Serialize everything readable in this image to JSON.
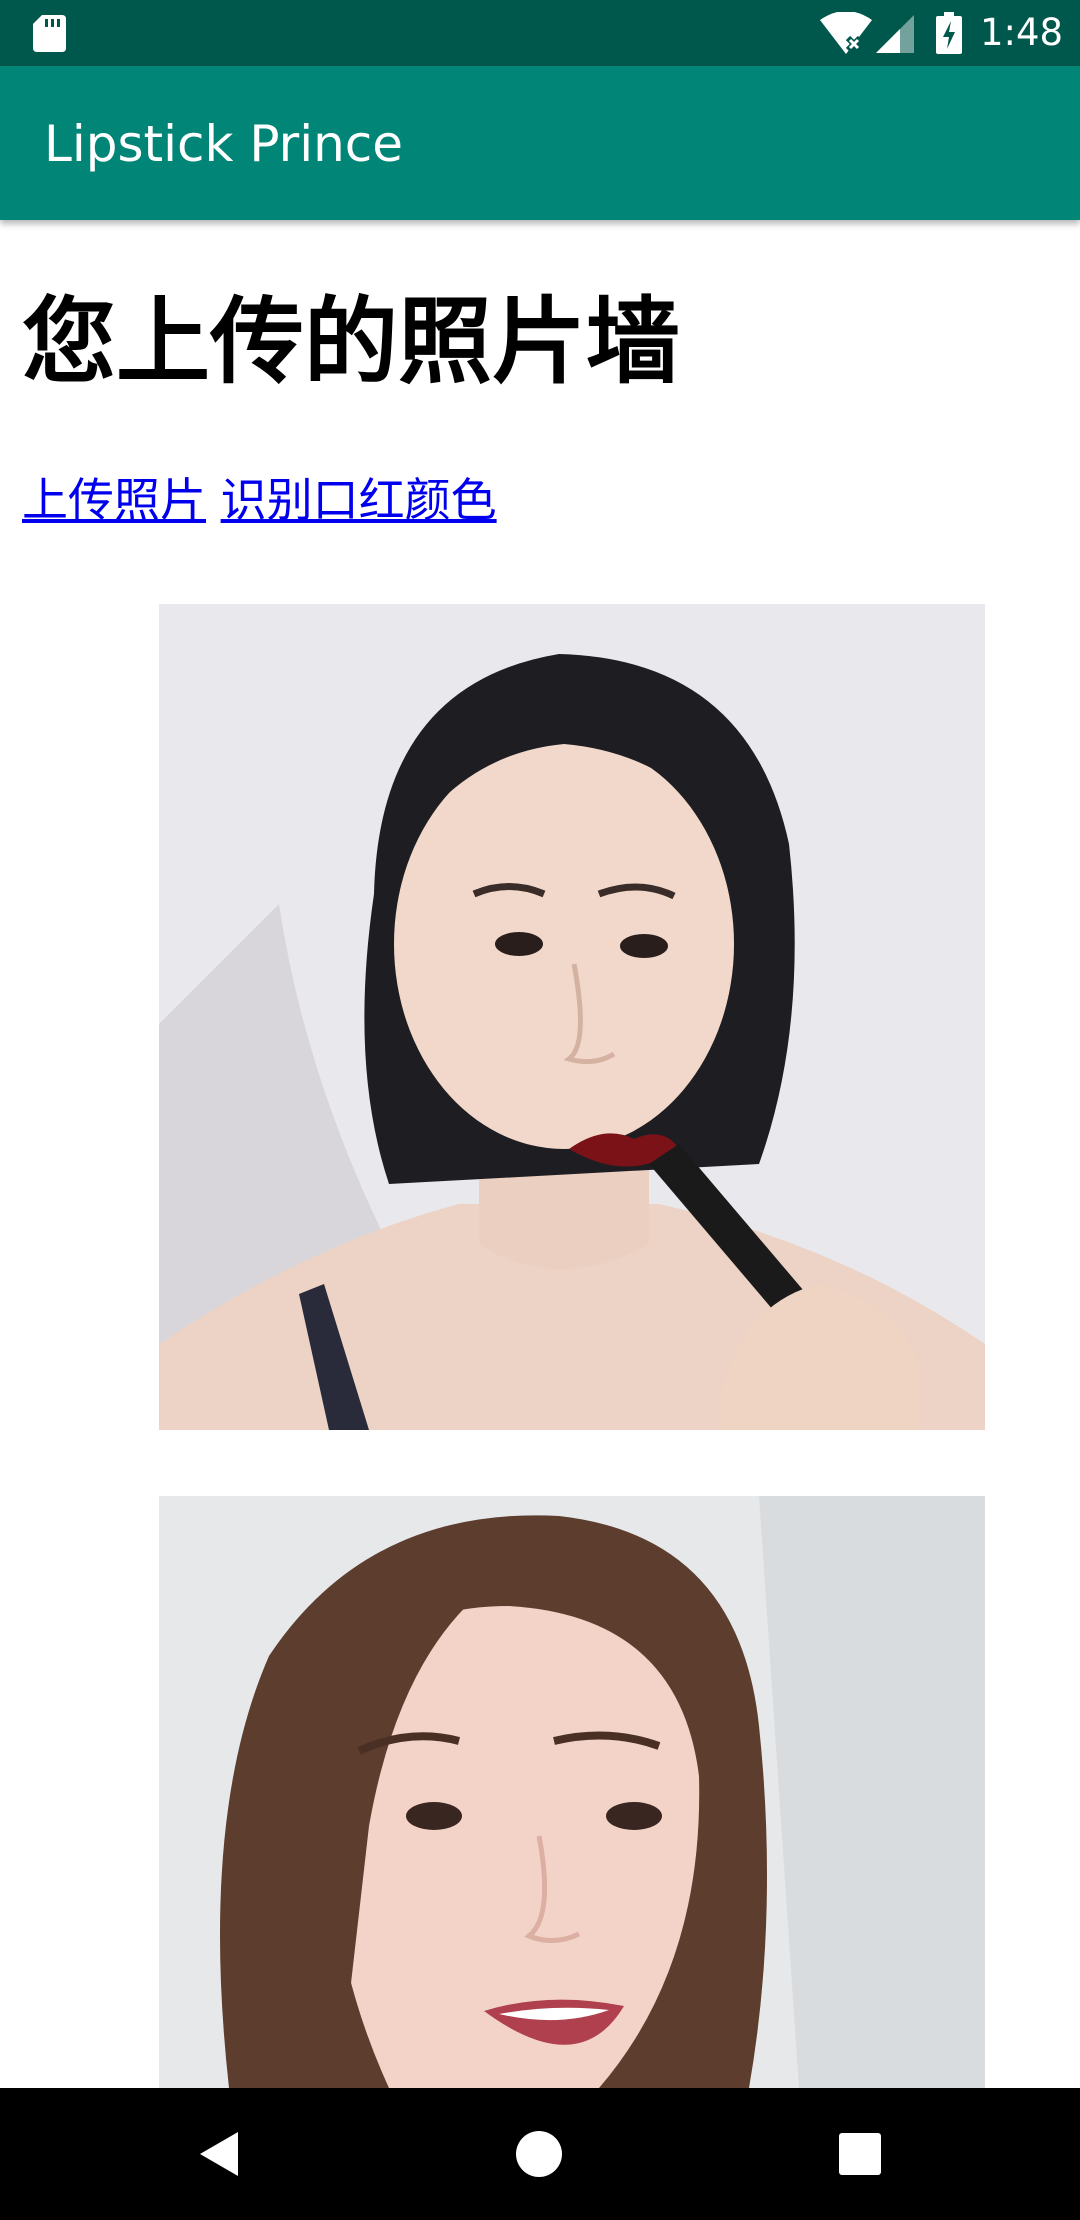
{
  "status_bar": {
    "time": "1:48",
    "icons": [
      "sd-card-icon",
      "wifi-icon",
      "cell-signal-icon",
      "battery-charging-icon"
    ],
    "background": "#00574b"
  },
  "app_bar": {
    "title": "Lipstick Prince",
    "background": "#008577"
  },
  "page": {
    "heading": "您上传的照片墙",
    "links": [
      {
        "label": "上传照片"
      },
      {
        "label": "识别口红颜色"
      }
    ],
    "link_color": "#0000ee"
  },
  "photos": [
    {
      "description_icon": "portrait-photo-1"
    },
    {
      "description_icon": "portrait-photo-2"
    }
  ],
  "nav_bar": {
    "buttons": [
      "back-icon",
      "home-icon",
      "recents-icon"
    ]
  }
}
